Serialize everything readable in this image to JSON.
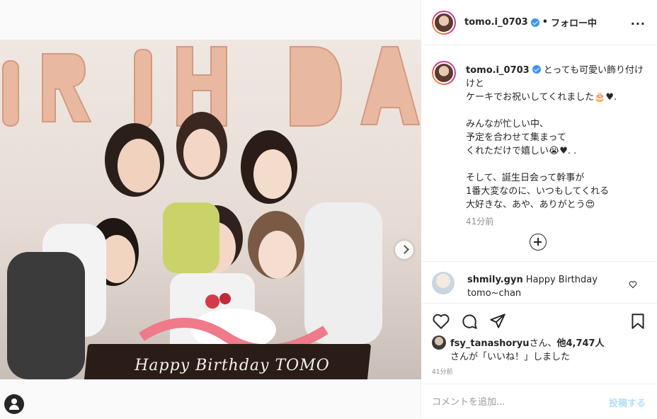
{
  "header": {
    "username": "tomo.i_0703",
    "separator": "•",
    "follow_label": "フォロー中",
    "more_label": "···"
  },
  "photo": {
    "cake_text": "Happy Birthday TOMO",
    "balloon_letters": [
      "I",
      "R",
      "T",
      "H",
      "D",
      "A"
    ]
  },
  "caption": {
    "username": "tomo.i_0703",
    "lines": [
      "とっても可愛い飾り付け",
      "けと",
      "ケーキでお祝いしてくれました🎂♥.",
      "",
      "みんなが忙しい中、",
      "予定を合わせて集まって",
      "くれただけで嬉しい😭♥. .",
      "",
      "そして、誕生日会って幹事が",
      "1番大変なのに、いつもしてくれる",
      "大好きな、あや、ありがとう😍"
    ],
    "time": "41分前"
  },
  "comment": {
    "username": "shmily.gyn",
    "text": "Happy Birthday",
    "text2": "tomo~chan"
  },
  "likes": {
    "liker": "fsy_tanashoryu",
    "middle": "さん、",
    "count": "他4,747人",
    "line2": "さんが「いいね！」しました"
  },
  "post_time": "41分前",
  "add_comment": {
    "placeholder": "コメントを追加...",
    "post_label": "投稿する"
  },
  "colors": {
    "verified": "#3897f0",
    "post_disabled": "#b2dffc",
    "secondary_text": "#8e8e8e"
  }
}
